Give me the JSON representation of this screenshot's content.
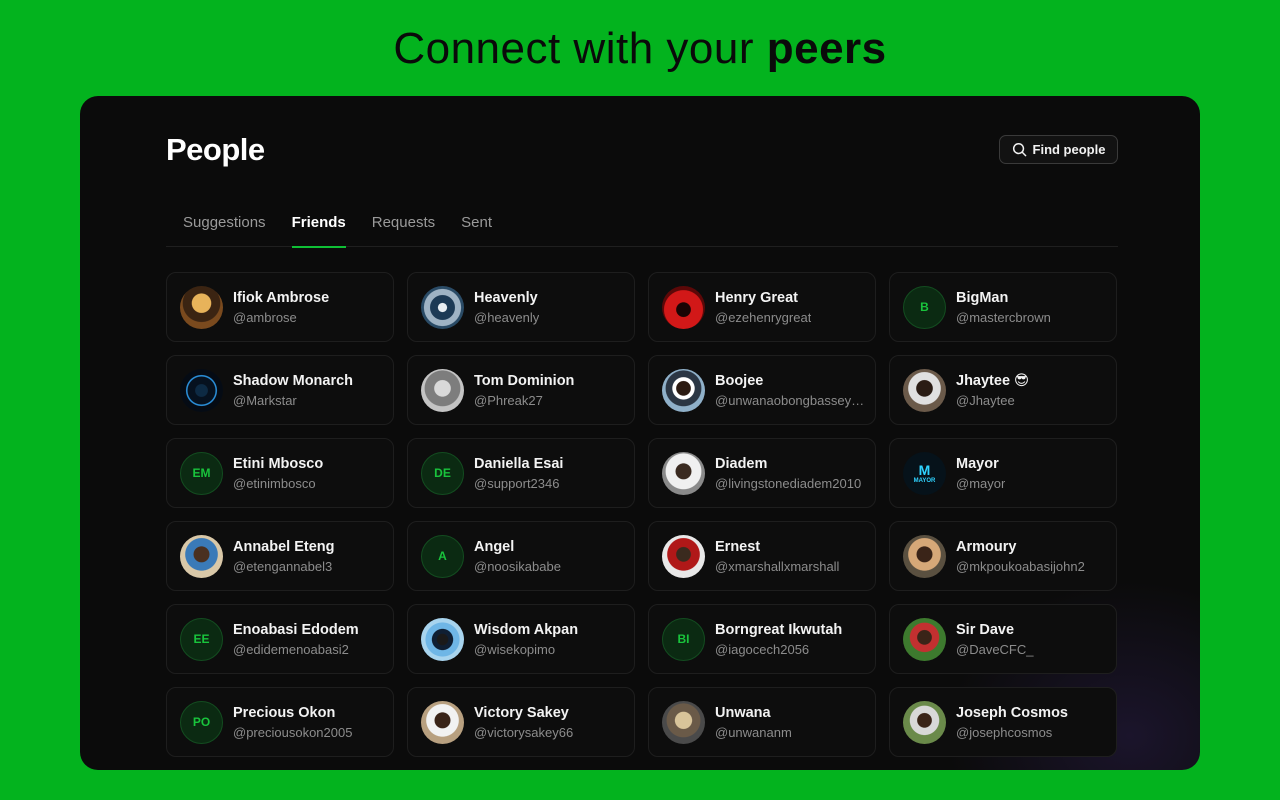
{
  "hero": {
    "text": "Connect with your ",
    "bold": "peers"
  },
  "page": {
    "title": "People"
  },
  "find_button": {
    "label": "Find people",
    "icon": "search-icon"
  },
  "tabs": [
    {
      "label": "Suggestions",
      "active": false
    },
    {
      "label": "Friends",
      "active": true
    },
    {
      "label": "Requests",
      "active": false
    },
    {
      "label": "Sent",
      "active": false
    }
  ],
  "colors": {
    "background": "#03b31e",
    "panel": "#0b0b0b",
    "accent": "#0fbf35"
  },
  "people": [
    {
      "name": "Ifiok Ambrose",
      "handle": "@ambrose",
      "avatar": "photo"
    },
    {
      "name": "Heavenly",
      "handle": "@heavenly",
      "avatar": "photo"
    },
    {
      "name": "Henry Great",
      "handle": "@ezehenrygreat",
      "avatar": "photo"
    },
    {
      "name": "BigMan",
      "handle": "@mastercbrown",
      "avatar": "initials",
      "initials": "B"
    },
    {
      "name": "Shadow Monarch",
      "handle": "@Markstar",
      "avatar": "photo"
    },
    {
      "name": "Tom Dominion",
      "handle": "@Phreak27",
      "avatar": "photo"
    },
    {
      "name": "Boojee",
      "handle": "@unwanaobongbassey…",
      "avatar": "photo"
    },
    {
      "name": "Jhaytee 😎",
      "handle": "@Jhaytee",
      "avatar": "photo"
    },
    {
      "name": "Etini Mbosco",
      "handle": "@etinimbosco",
      "avatar": "initials",
      "initials": "EM"
    },
    {
      "name": "Daniella Esai",
      "handle": "@support2346",
      "avatar": "initials",
      "initials": "DE"
    },
    {
      "name": "Diadem",
      "handle": "@livingstonediadem2010",
      "avatar": "photo"
    },
    {
      "name": "Mayor",
      "handle": "@mayor",
      "avatar": "logo",
      "logo_text": "MAYOR"
    },
    {
      "name": "Annabel Eteng",
      "handle": "@etengannabel3",
      "avatar": "photo"
    },
    {
      "name": "Angel",
      "handle": "@noosikababe",
      "avatar": "initials",
      "initials": "A"
    },
    {
      "name": "Ernest",
      "handle": "@xmarshallxmarshall",
      "avatar": "photo"
    },
    {
      "name": "Armoury",
      "handle": "@mkpoukoabasijohn2",
      "avatar": "photo"
    },
    {
      "name": "Enoabasi Edodem",
      "handle": "@edidemenoabasi2",
      "avatar": "initials",
      "initials": "EE"
    },
    {
      "name": "Wisdom Akpan",
      "handle": "@wisekopimo",
      "avatar": "photo"
    },
    {
      "name": "Borngreat Ikwutah",
      "handle": "@iagocech2056",
      "avatar": "initials",
      "initials": "BI"
    },
    {
      "name": "Sir Dave",
      "handle": "@DaveCFC_",
      "avatar": "photo"
    },
    {
      "name": "Precious Okon",
      "handle": "@preciousokon2005",
      "avatar": "initials",
      "initials": "PO"
    },
    {
      "name": "Victory Sakey",
      "handle": "@victorysakey66",
      "avatar": "photo"
    },
    {
      "name": "Unwana",
      "handle": "@unwananm",
      "avatar": "photo"
    },
    {
      "name": "Joseph Cosmos",
      "handle": "@josephcosmos",
      "avatar": "photo"
    }
  ]
}
